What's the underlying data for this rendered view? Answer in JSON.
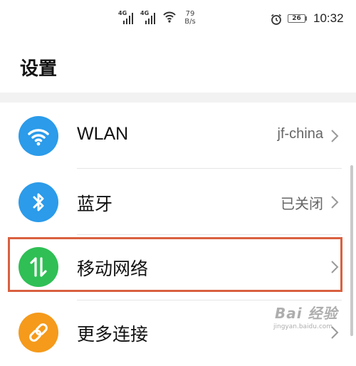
{
  "status_bar": {
    "network_tag_1": "4G",
    "network_tag_2": "4G",
    "speed_value": "79",
    "speed_unit": "B/s",
    "battery_level": "26",
    "time": "10:32"
  },
  "header": {
    "title": "设置"
  },
  "settings": {
    "items": [
      {
        "label": "WLAN",
        "value": "jf-china",
        "icon": "wifi-icon",
        "icon_color": "#2b9bea"
      },
      {
        "label": "蓝牙",
        "value": "已关闭",
        "icon": "bluetooth-icon",
        "icon_color": "#2b9bea"
      },
      {
        "label": "移动网络",
        "value": "",
        "icon": "mobile-data-icon",
        "icon_color": "#2fbf55"
      },
      {
        "label": "更多连接",
        "value": "",
        "icon": "link-icon",
        "icon_color": "#f59a1b"
      }
    ]
  },
  "highlight_color": "#d9603f",
  "watermark": {
    "text": "Bai 经验",
    "sub": "jingyan.baidu.com"
  }
}
